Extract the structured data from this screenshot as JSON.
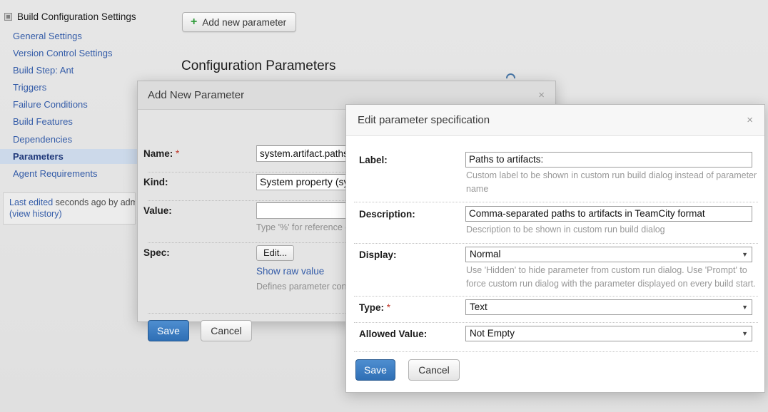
{
  "sidebar": {
    "root_label": "Build Configuration Settings",
    "items": [
      {
        "label": "General Settings",
        "selected": false
      },
      {
        "label": "Version Control Settings",
        "selected": false
      },
      {
        "label": "Build Step: Ant",
        "selected": false
      },
      {
        "label": "Triggers",
        "selected": false
      },
      {
        "label": "Failure Conditions",
        "selected": false
      },
      {
        "label": "Build Features",
        "selected": false
      },
      {
        "label": "Dependencies",
        "selected": false
      },
      {
        "label": "Parameters",
        "selected": true
      },
      {
        "label": "Agent Requirements",
        "selected": false
      }
    ],
    "last_edited": {
      "prefix": "Last edited",
      "text": "seconds ago  by adm",
      "history_link": "(view history)"
    }
  },
  "main": {
    "add_button_label": "Add new parameter",
    "add_button_icon": "plus-icon",
    "section_title": "Configuration Parameters"
  },
  "add_dialog": {
    "title": "Add New Parameter",
    "close_glyph": "×",
    "rows": {
      "name": {
        "label": "Name:",
        "required": "*",
        "value": "system.artifact.paths"
      },
      "kind": {
        "label": "Kind:",
        "value": "System property (sys"
      },
      "value": {
        "label": "Value:",
        "value": "",
        "hint": "Type '%' for reference c"
      },
      "spec": {
        "label": "Spec:",
        "edit_button": "Edit...",
        "raw_link": "Show raw value",
        "hint": "Defines parameter con"
      }
    },
    "save_label": "Save",
    "cancel_label": "Cancel"
  },
  "edit_dialog": {
    "title": "Edit parameter specification",
    "close_glyph": "×",
    "rows": {
      "label": {
        "label": "Label:",
        "value": "Paths to artifacts:",
        "hint_line1": "Custom label to be shown in custom run build dialog instead of parameter",
        "hint_line2": "name"
      },
      "description": {
        "label": "Description:",
        "value": "Comma-separated paths to artifacts in TeamCity format",
        "hint_line1": "Description to be shown in custom run build dialog"
      },
      "display": {
        "label": "Display:",
        "value": "Normal",
        "caret": "▼",
        "hint_line1": "Use 'Hidden' to hide parameter from custom run dialog. Use 'Prompt' to",
        "hint_line2": "force custom run dialog with the parameter displayed on every build start."
      },
      "type": {
        "label": "Type:",
        "required": "*",
        "value": "Text",
        "caret": "▼"
      },
      "allowed_value": {
        "label": "Allowed Value:",
        "value": "Not Empty",
        "caret": "▼"
      }
    },
    "save_label": "Save",
    "cancel_label": "Cancel"
  },
  "colors": {
    "accent_blue": "#2f6fb5",
    "link_blue": "#345ca8",
    "selected_bg": "#ccd9ea",
    "plus_green": "#2b9a36",
    "required_red": "#c0392b",
    "page_bg": "#e3e3e3"
  }
}
